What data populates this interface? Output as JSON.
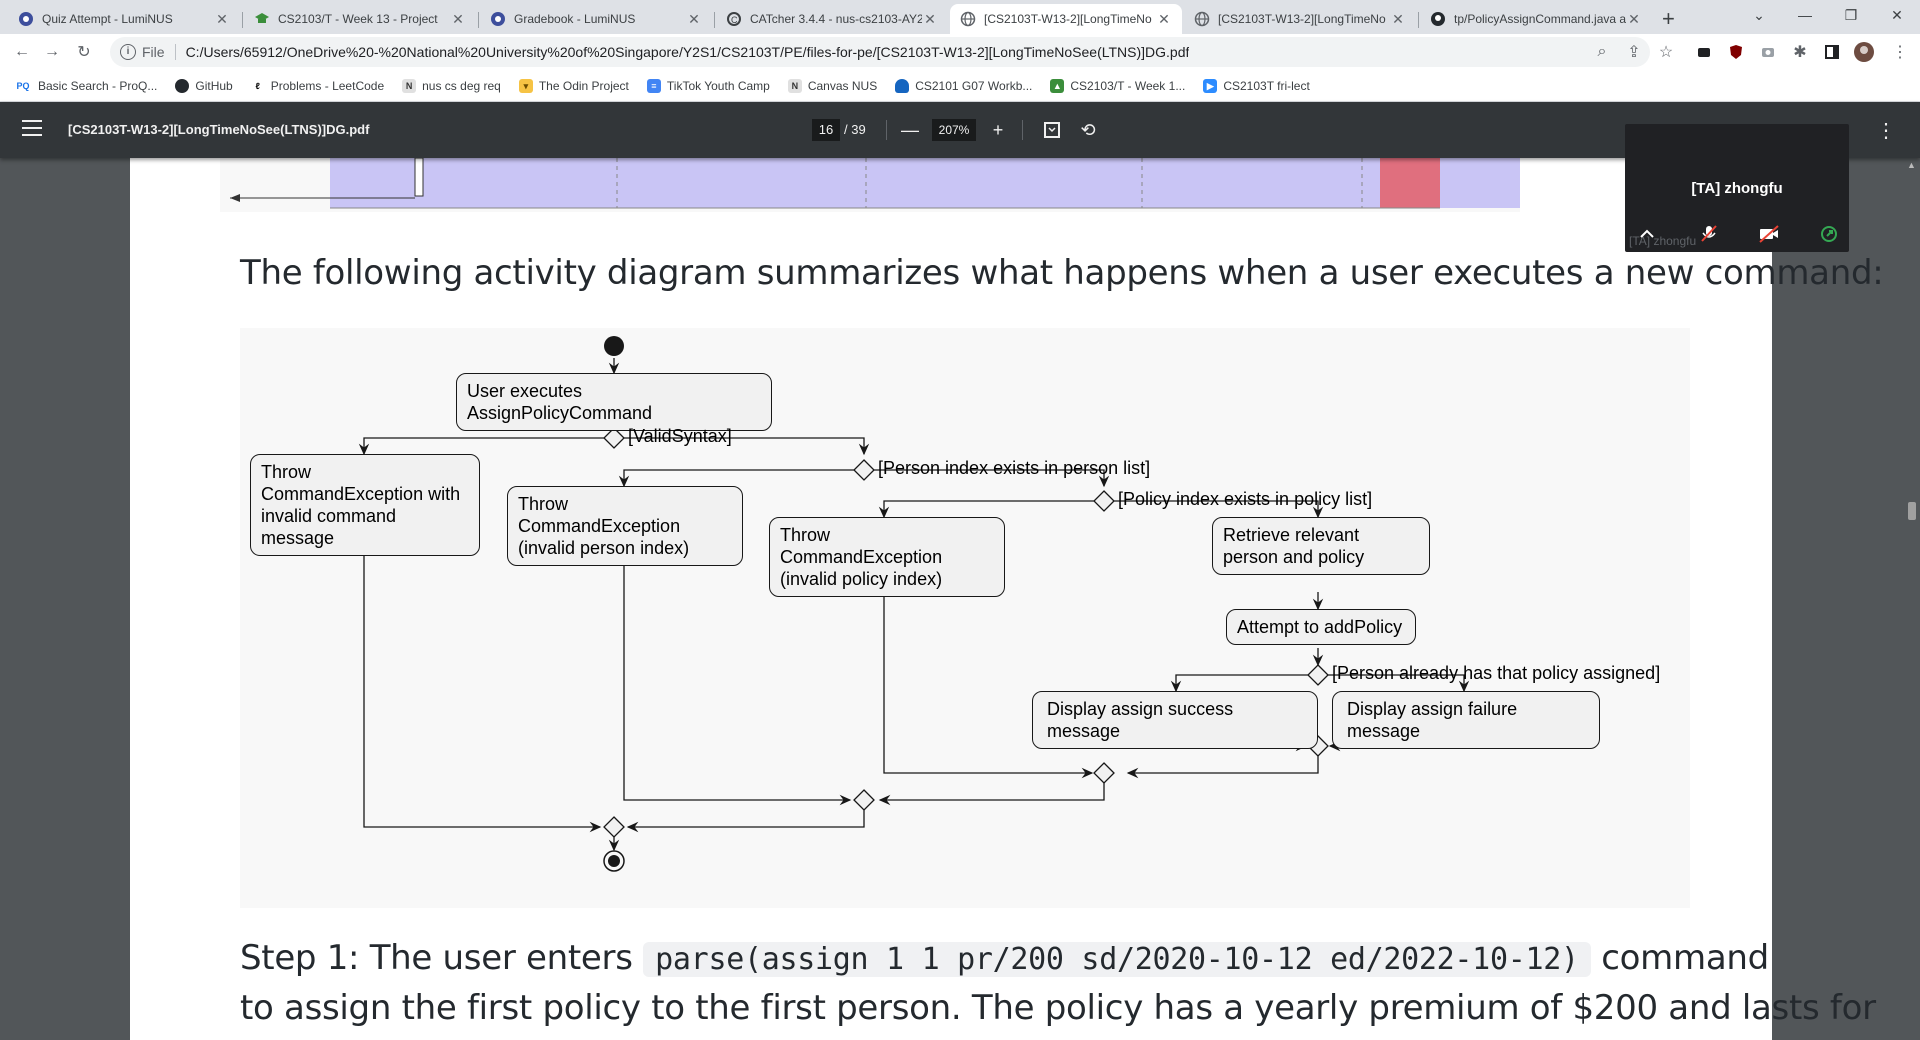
{
  "tabs": [
    {
      "title": "Quiz Attempt - LumiNUS",
      "icon": "luminus-icon"
    },
    {
      "title": "CS2103/T - Week 13 - Project",
      "icon": "graduation-cap-icon"
    },
    {
      "title": "Gradebook - LumiNUS",
      "icon": "luminus-icon"
    },
    {
      "title": "CATcher 3.4.4 - nus-cs2103-AY2",
      "icon": "catcher-icon"
    },
    {
      "title": "[CS2103T-W13-2][LongTimeNo",
      "icon": "globe-icon"
    },
    {
      "title": "[CS2103T-W13-2][LongTimeNo",
      "icon": "globe-icon"
    },
    {
      "title": "tp/PolicyAssignCommand.java a",
      "icon": "github-icon"
    }
  ],
  "address_bar": {
    "scheme_label": "File",
    "url": "C:/Users/65912/OneDrive%20-%20National%20University%20of%20Singapore/Y2S1/CS2103T/PE/files-for-pe/[CS2103T-W13-2][LongTimeNoSee(LTNS)]DG.pdf"
  },
  "bookmarks": [
    {
      "label": "Basic Search - ProQ...",
      "icon": "pq-icon"
    },
    {
      "label": "GitHub",
      "icon": "github-icon"
    },
    {
      "label": "Problems - LeetCode",
      "icon": "leetcode-icon"
    },
    {
      "label": "nus cs deg req",
      "icon": "nus-icon"
    },
    {
      "label": "The Odin Project",
      "icon": "odin-icon"
    },
    {
      "label": "TikTok Youth Camp",
      "icon": "doc-icon"
    },
    {
      "label": "Canvas NUS",
      "icon": "nus-icon"
    },
    {
      "label": "CS2101 G07 Workb...",
      "icon": "cloud-icon"
    },
    {
      "label": "CS2103/T - Week 1...",
      "icon": "graduation-cap-icon"
    },
    {
      "label": "CS2103T fri-lect",
      "icon": "zoom-icon"
    }
  ],
  "pdf_viewer": {
    "file_title": "[CS2103T-W13-2][LongTimeNoSee(LTNS)]DG.pdf",
    "current_page": "16",
    "total_pages": "/ 39",
    "zoom": "207%"
  },
  "document": {
    "intro_text": "The following activity diagram summarizes what happens when a user executes a new command:",
    "step1_prefix": "Step 1: The user enters",
    "step1_code": "parse(assign 1 1 pr/200 sd/2020-10-12 ed/2022-10-12)",
    "step1_suffix": "command",
    "step1_line2": "to assign the first policy to the first person. The policy has a yearly premium of $200 and lasts for"
  },
  "diagram": {
    "nodes": {
      "start_action": "User executes AssignPolicyCommand",
      "invalid_command": "Throw CommandException with invalid command message",
      "invalid_person": "Throw CommandException (invalid person index)",
      "invalid_policy": "Throw CommandException (invalid policy index)",
      "retrieve": "Retrieve relevant person and policy",
      "attempt": "Attempt to addPolicy",
      "success": "Display assign success message",
      "failure": "Display assign failure message"
    },
    "guards": {
      "valid_syntax": "[ValidSyntax]",
      "person_exists": "[Person index exists in person list]",
      "policy_exists": "[Policy index exists in policy list]",
      "already_assigned": "[Person already has that policy assigned]"
    }
  },
  "call_overlay": {
    "participant": "[TA] zhongfu",
    "ghost_label": "[TA] zhongfu"
  }
}
